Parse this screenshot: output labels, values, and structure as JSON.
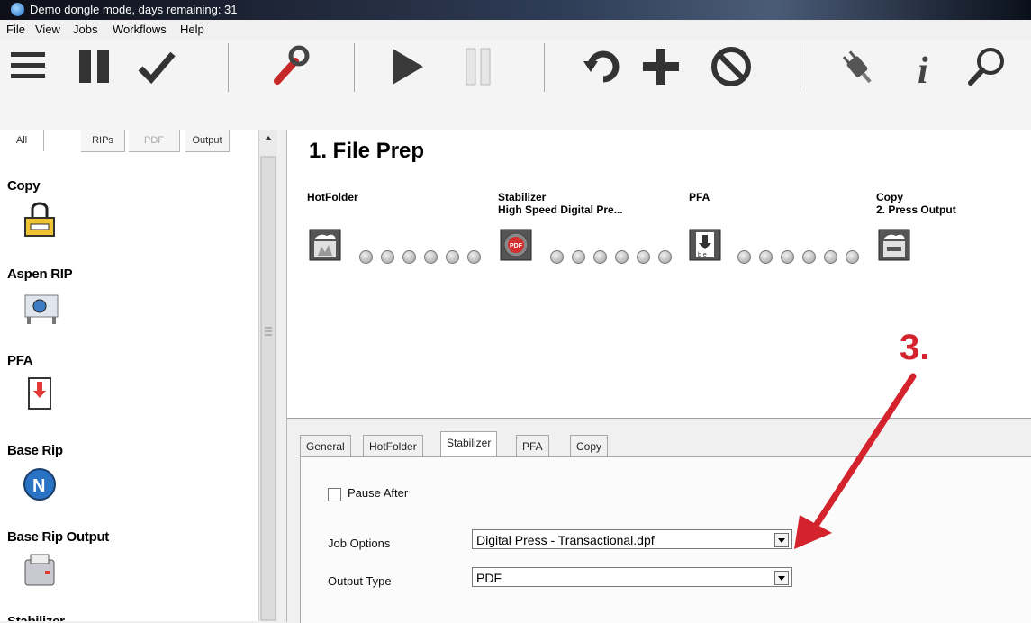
{
  "window": {
    "title": "Demo dongle mode, days remaining: 31"
  },
  "menu": [
    "File",
    "View",
    "Jobs",
    "Workflows",
    "Help"
  ],
  "toolbar": {
    "buttons": [
      "menu-lines-icon",
      "pause-icon",
      "checkmark-icon",
      "wrench-icon",
      "play-icon",
      "pause-thin-icon",
      "undo-icon",
      "add-icon",
      "stop-icon",
      "plug-icon",
      "info-icon",
      "magnify-icon"
    ]
  },
  "left_tabs": [
    "All",
    "RIPs",
    "PDF",
    "Output"
  ],
  "tools": [
    {
      "label": "Copy",
      "icon": "copy-icon"
    },
    {
      "label": "Aspen RIP",
      "icon": "printer-icon"
    },
    {
      "label": "PFA",
      "icon": "pfa-icon"
    },
    {
      "label": "Base Rip",
      "icon": "base-rip-icon"
    },
    {
      "label": "Base Rip Output",
      "icon": "output-device-icon"
    },
    {
      "label": "Stabilizer",
      "icon": ""
    }
  ],
  "workflow": {
    "title": "1. File Prep",
    "nodes": [
      {
        "label1": "HotFolder",
        "label2": "",
        "icon": "hotfolder-icon"
      },
      {
        "label1": "Stabilizer",
        "label2": "High Speed Digital Pre...",
        "icon": "stabilizer-icon"
      },
      {
        "label1": "PFA",
        "label2": "",
        "icon": "pfa-node-icon"
      },
      {
        "label1": "Copy",
        "label2": "2. Press Output",
        "icon": "copy-node-icon"
      }
    ]
  },
  "props": {
    "tabs": [
      "General",
      "HotFolder",
      "Stabilizer",
      "PFA",
      "Copy"
    ],
    "active_tab": "Stabilizer",
    "pause_after_label": "Pause After",
    "pause_after_checked": false,
    "job_options_label": "Job Options",
    "job_options_value": "Digital Press - Transactional.dpf",
    "output_type_label": "Output Type",
    "output_type_value": "PDF"
  },
  "annotation": {
    "text": "3.",
    "color": "#d4232c"
  }
}
